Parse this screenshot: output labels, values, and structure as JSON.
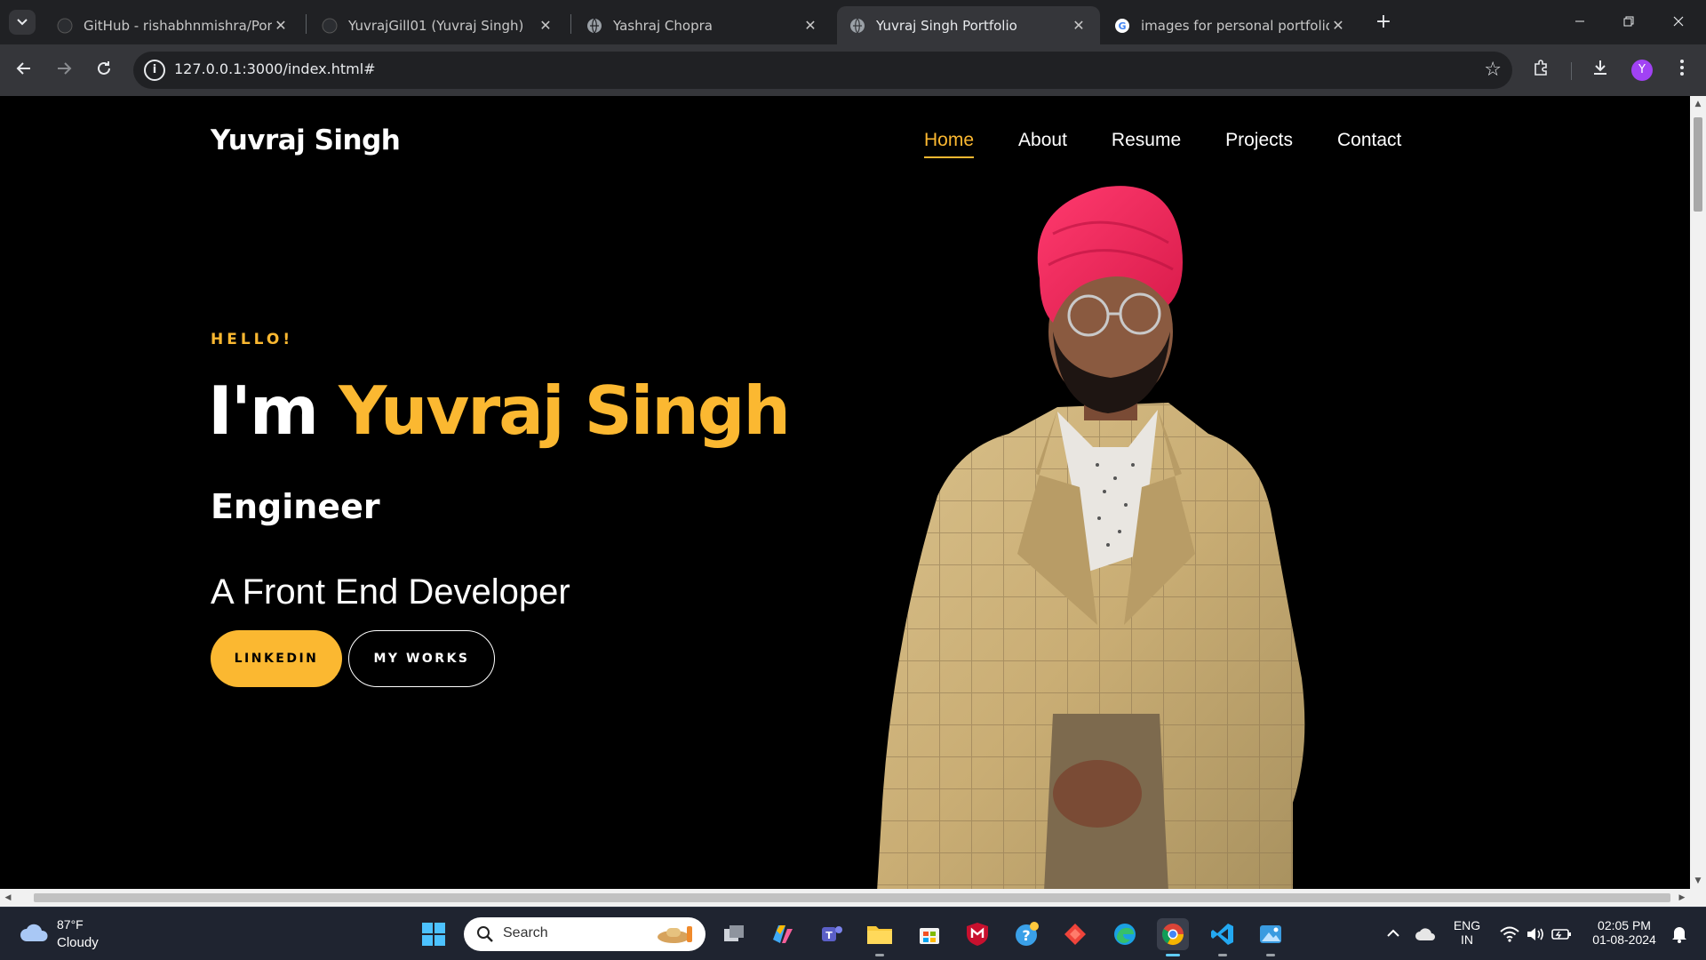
{
  "browser": {
    "tabs": [
      {
        "title": "GitHub - rishabhnmishra/Portfo",
        "favicon": "github-icon",
        "active": false
      },
      {
        "title": "YuvrajGill01 (Yuvraj Singh)",
        "favicon": "github-icon",
        "active": false
      },
      {
        "title": "Yashraj Chopra",
        "favicon": "globe-icon",
        "active": false
      },
      {
        "title": "Yuvraj Singh Portfolio",
        "favicon": "globe-icon",
        "active": true
      },
      {
        "title": "images for personal portfolio - G",
        "favicon": "google-icon",
        "active": false
      }
    ],
    "url": "127.0.0.1:3000/index.html#",
    "profile_initial": "Y",
    "profile_color": "#a142f4"
  },
  "site": {
    "brand": "Yuvraj Singh",
    "nav": [
      {
        "label": "Home",
        "active": true
      },
      {
        "label": "About",
        "active": false
      },
      {
        "label": "Resume",
        "active": false
      },
      {
        "label": "Projects",
        "active": false
      },
      {
        "label": "Contact",
        "active": false
      }
    ],
    "hero": {
      "greeting": "HELLO!",
      "intro": "I'm ",
      "name": "Yuvraj Singh",
      "role": "Engineer",
      "tagline": "A Front End Developer",
      "primary_button": "LINKEDIN",
      "secondary_button": "MY WORKS"
    },
    "accent_color": "#fbb831"
  },
  "taskbar": {
    "weather": {
      "temp": "87°F",
      "condition": "Cloudy"
    },
    "search_label": "Search",
    "language": {
      "line1": "ENG",
      "line2": "IN"
    },
    "clock": {
      "time": "02:05 PM",
      "date": "01-08-2024"
    }
  }
}
